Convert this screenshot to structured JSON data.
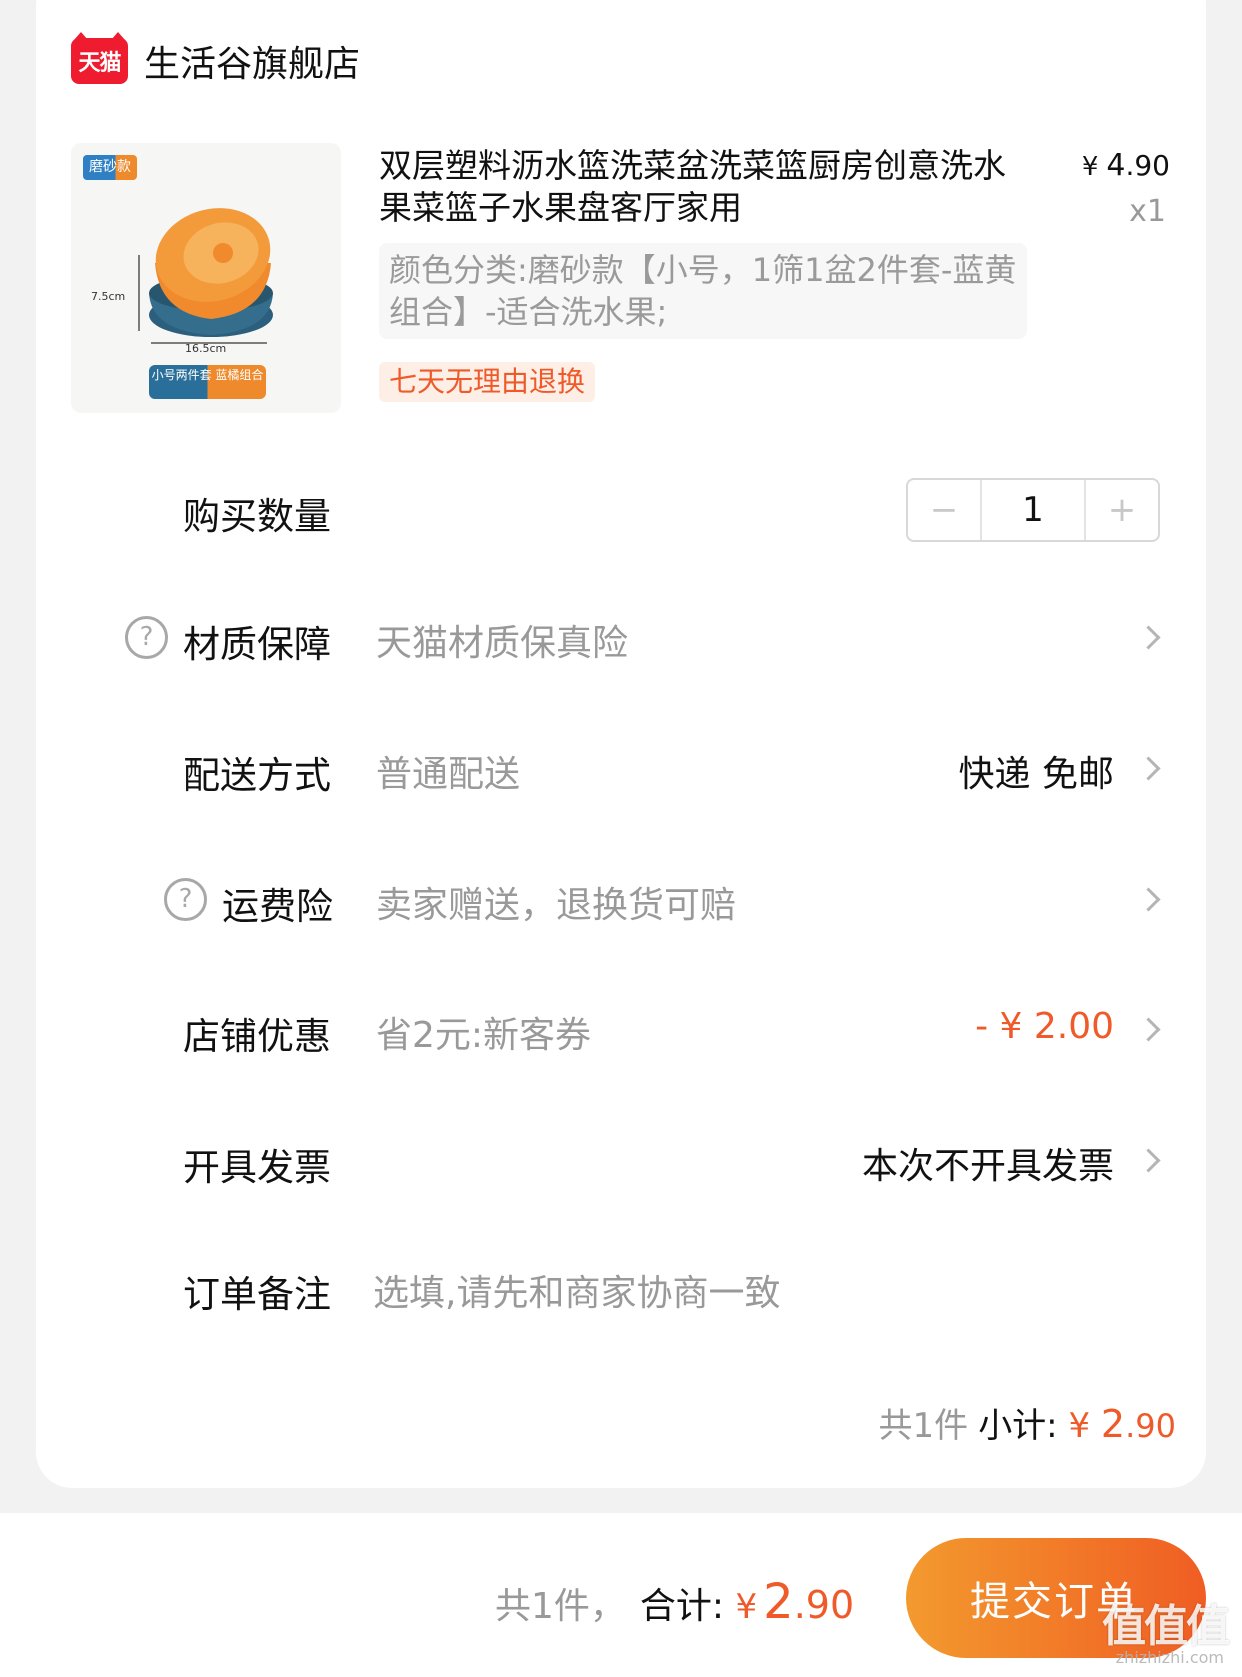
{
  "store": {
    "logo_text": "天猫",
    "name": "生活谷旗舰店"
  },
  "product": {
    "title": "双层塑料沥水篮洗菜盆洗菜篮厨房创意洗水果菜篮子水果盘客厅家用",
    "price_currency": "¥",
    "price_int": "4",
    "price_dec": ".90",
    "quantity": "x1",
    "spec": "颜色分类:磨砂款【小号，1筛1盆2件套-蓝黄组合】-适合洗水果;",
    "return_tag": "七天无理由退换",
    "image_badge": "磨砂款",
    "image_dim_height": "7.5cm",
    "image_dim_width": "16.5cm",
    "image_bottom_label": "小号两件套 蓝橘组合"
  },
  "quantity_row": {
    "label": "购买数量",
    "value": "1",
    "minus": "−",
    "plus": "+"
  },
  "material_row": {
    "label": "材质保障",
    "value": "天猫材质保真险"
  },
  "delivery_row": {
    "label": "配送方式",
    "value": "普通配送",
    "right": "快递 免邮"
  },
  "freight_row": {
    "label": "运费险",
    "value": "卖家赠送，退换货可赔"
  },
  "discount_row": {
    "label": "店铺优惠",
    "value": "省2元:新客券",
    "right": "- ¥ 2.00"
  },
  "invoice_row": {
    "label": "开具发票",
    "right": "本次不开具发票"
  },
  "note_row": {
    "label": "订单备注",
    "placeholder": "选填,请先和商家协商一致"
  },
  "subtotal": {
    "count": "共1件",
    "label": "小计:",
    "currency": "¥ ",
    "int": "2",
    "dec": ".90"
  },
  "footer": {
    "count": "共1件，",
    "label": "合计:",
    "currency": "¥",
    "int": "2",
    "dec": ".90",
    "submit": "提交订单"
  },
  "watermark": {
    "text": "值值值",
    "sub": "zhizhizhi.com"
  },
  "colors": {
    "accent": "#ef5a2a",
    "tmall_red": "#ee1c2e"
  }
}
